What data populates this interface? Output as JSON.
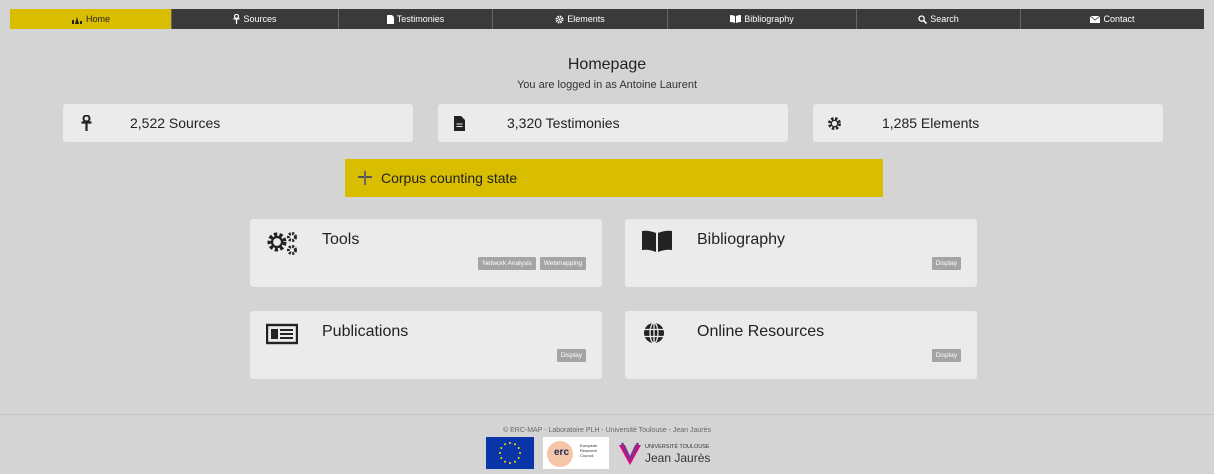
{
  "nav": {
    "items": [
      {
        "label": "Home",
        "icon": "home-icon",
        "active": true
      },
      {
        "label": "Sources",
        "icon": "ankh-icon",
        "active": false
      },
      {
        "label": "Testimonies",
        "icon": "file-icon",
        "active": false
      },
      {
        "label": "Elements",
        "icon": "gear-icon",
        "active": false
      },
      {
        "label": "Bibliography",
        "icon": "book-icon",
        "active": false
      },
      {
        "label": "Search",
        "icon": "search-icon",
        "active": false
      },
      {
        "label": "Contact",
        "icon": "envelope-icon",
        "active": false
      }
    ]
  },
  "header": {
    "title": "Homepage",
    "subtitle": "You are logged in as Antoine Laurent"
  },
  "stats": [
    {
      "label": "2,522 Sources",
      "icon": "ankh-icon"
    },
    {
      "label": "3,320 Testimonies",
      "icon": "file-icon"
    },
    {
      "label": "1,285 Elements",
      "icon": "gear-icon"
    }
  ],
  "corpus": {
    "label": "Corpus counting state",
    "icon": "plus-icon"
  },
  "cards": {
    "tools": {
      "title": "Tools",
      "icon": "cogs-icon",
      "buttons": [
        "Network Analysis",
        "Webmapping"
      ]
    },
    "bibliography": {
      "title": "Bibliography",
      "icon": "book-icon",
      "buttons": [
        "Display"
      ]
    },
    "publications": {
      "title": "Publications",
      "icon": "newspaper-icon",
      "buttons": [
        "Display"
      ]
    },
    "online": {
      "title": "Online Resources",
      "icon": "globe-icon",
      "buttons": [
        "Display"
      ]
    }
  },
  "footer": {
    "text": "© ERC-MAP - Laboratoire PLH - Université Toulouse - Jean Jaurès",
    "logos": {
      "erc_text": "erc",
      "erc_caption": [
        "European",
        "Research",
        "Council"
      ],
      "ut_line1": "UNIVERSITÉ TOULOUSE",
      "ut_line2": "Jean Jaurès"
    }
  },
  "colors": {
    "accent": "#d9bd00",
    "nav_bg": "#3a3a3a",
    "page_bg": "#d4d4d4",
    "card_bg": "#ebebeb",
    "button_bg": "#a4a4a4"
  }
}
